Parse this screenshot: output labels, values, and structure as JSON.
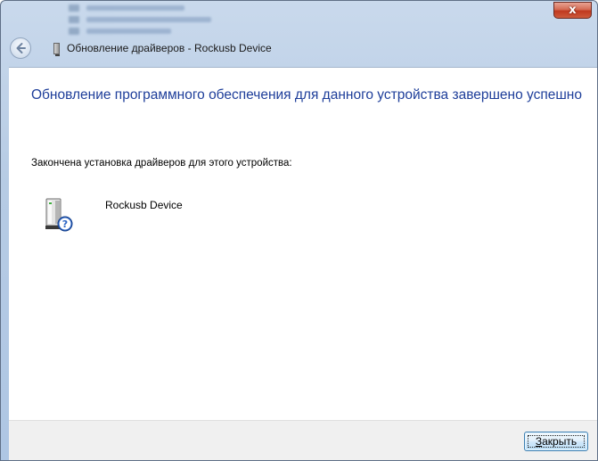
{
  "window": {
    "title": "Обновление драйверов - Rockusb Device",
    "close_glyph": "x"
  },
  "content": {
    "heading": "Обновление программного обеспечения для данного устройства завершено успешно",
    "subtext": "Закончена установка драйверов для этого устройства:",
    "device": {
      "name": "Rockusb Device",
      "icon": "unknown-device-icon"
    }
  },
  "footer": {
    "close_button": {
      "mnemonic": "З",
      "rest": "акрыть"
    }
  },
  "icons": {
    "back": "back-arrow-icon",
    "title_device": "device-icon"
  },
  "colors": {
    "heading": "#1e3e9a",
    "close_button_red": "#c0391f",
    "button_border": "#3c7fb1"
  }
}
